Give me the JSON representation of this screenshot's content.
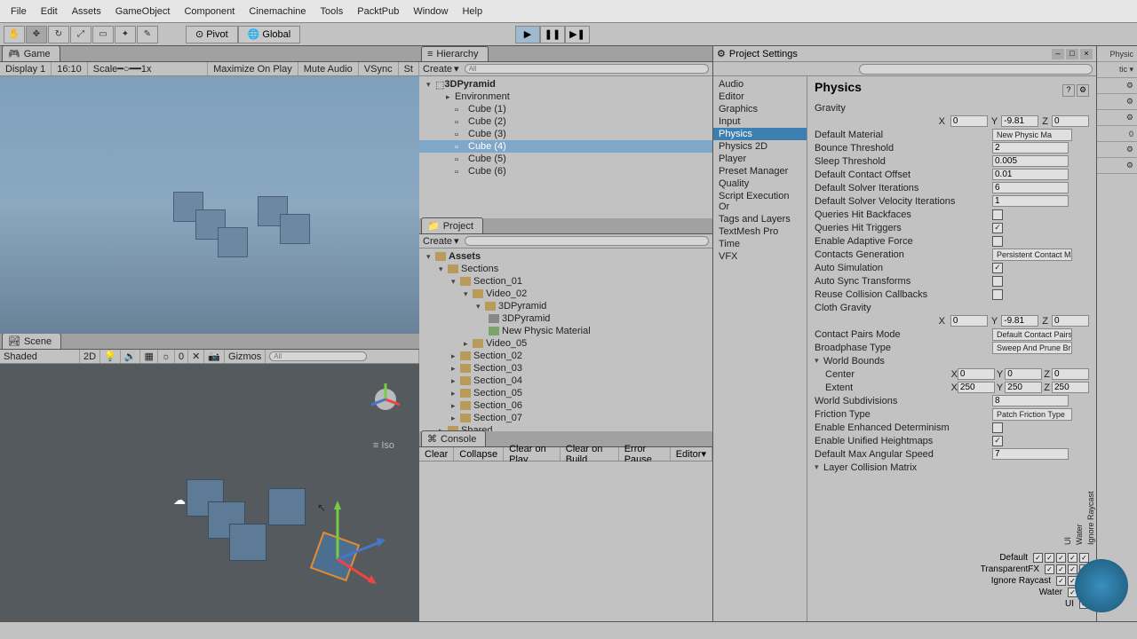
{
  "menubar": [
    "File",
    "Edit",
    "Assets",
    "GameObject",
    "Component",
    "Cinemachine",
    "Tools",
    "PacktPub",
    "Window",
    "Help"
  ],
  "toolbar": {
    "pivot": "Pivot",
    "global": "Global"
  },
  "game": {
    "tab": "Game",
    "display": "Display 1",
    "aspect": "16:10",
    "scale": "Scale",
    "scale_val": "1x",
    "maximize": "Maximize On Play",
    "mute": "Mute Audio",
    "vsync": "VSync",
    "stats": "St"
  },
  "scene": {
    "tab": "Scene",
    "shade": "Shaded",
    "twod": "2D",
    "gizmos": "Gizmos",
    "iso": "Iso"
  },
  "hierarchy": {
    "tab": "Hierarchy",
    "create": "Create",
    "all_prefix": "All",
    "scene_name": "3DPyramid",
    "items": [
      "Environment",
      "Cube (1)",
      "Cube (2)",
      "Cube (3)",
      "Cube (4)",
      "Cube (5)",
      "Cube (6)"
    ],
    "selected": 4
  },
  "project": {
    "tab": "Project",
    "create": "Create",
    "tree": {
      "assets": "Assets",
      "sections": "Sections",
      "s1": "Section_01",
      "v2": "Video_02",
      "pyr": "3DPyramid",
      "pyr_scene": "3DPyramid",
      "mat": "New Physic Material",
      "v5": "Video_05",
      "s2": "Section_02",
      "s3": "Section_03",
      "s4": "Section_04",
      "s5": "Section_05",
      "s6": "Section_06",
      "s7": "Section_07",
      "shared": "Shared"
    }
  },
  "console": {
    "tab": "Console",
    "clear": "Clear",
    "collapse": "Collapse",
    "clear_play": "Clear on Play",
    "clear_build": "Clear on Build",
    "error_pause": "Error Pause",
    "editor": "Editor"
  },
  "ps": {
    "title": "Project Settings",
    "cats": [
      "Audio",
      "Editor",
      "Graphics",
      "Input",
      "Physics",
      "Physics 2D",
      "Player",
      "Preset Manager",
      "Quality",
      "Script Execution Or",
      "Tags and Layers",
      "TextMesh Pro",
      "Time",
      "VFX"
    ],
    "selected_cat": 4,
    "heading": "Physics",
    "gravity_label": "Gravity",
    "gravity": {
      "x": "0",
      "y": "-9.81",
      "z": "0"
    },
    "default_material": {
      "label": "Default Material",
      "value": "New Physic Ma"
    },
    "bounce": {
      "label": "Bounce Threshold",
      "value": "2"
    },
    "sleep": {
      "label": "Sleep Threshold",
      "value": "0.005"
    },
    "contact_offset": {
      "label": "Default Contact Offset",
      "value": "0.01"
    },
    "solver_iter": {
      "label": "Default Solver Iterations",
      "value": "6"
    },
    "solver_vel": {
      "label": "Default Solver Velocity Iterations",
      "value": "1"
    },
    "queries_back": {
      "label": "Queries Hit Backfaces",
      "checked": false
    },
    "queries_trig": {
      "label": "Queries Hit Triggers",
      "checked": true
    },
    "adaptive": {
      "label": "Enable Adaptive Force",
      "checked": false
    },
    "contacts_gen": {
      "label": "Contacts Generation",
      "value": "Persistent Contact Ma"
    },
    "auto_sim": {
      "label": "Auto Simulation",
      "checked": true
    },
    "auto_sync": {
      "label": "Auto Sync Transforms",
      "checked": false
    },
    "reuse_coll": {
      "label": "Reuse Collision Callbacks",
      "checked": false
    },
    "cloth_gravity_label": "Cloth Gravity",
    "cloth_gravity": {
      "x": "0",
      "y": "-9.81",
      "z": "0"
    },
    "contact_pairs": {
      "label": "Contact Pairs Mode",
      "value": "Default Contact Pairs"
    },
    "broadphase": {
      "label": "Broadphase Type",
      "value": "Sweep And Prune Bro"
    },
    "world_bounds": "World Bounds",
    "center": {
      "label": "Center",
      "x": "0",
      "y": "0",
      "z": "0"
    },
    "extent": {
      "label": "Extent",
      "x": "250",
      "y": "250",
      "z": "250"
    },
    "world_subdiv": {
      "label": "World Subdivisions",
      "value": "8"
    },
    "friction": {
      "label": "Friction Type",
      "value": "Patch Friction Type"
    },
    "determinism": {
      "label": "Enable Enhanced Determinism",
      "checked": false
    },
    "heightmaps": {
      "label": "Enable Unified Heightmaps",
      "checked": true
    },
    "max_angular": {
      "label": "Default Max Angular Speed",
      "value": "7"
    },
    "layer_matrix": "Layer Collision Matrix",
    "layers": [
      "Default",
      "TransparentFX",
      "Ignore Raycast",
      "Water",
      "UI"
    ]
  },
  "right_inspector": {
    "physic": "Physic",
    "zero": "0"
  }
}
